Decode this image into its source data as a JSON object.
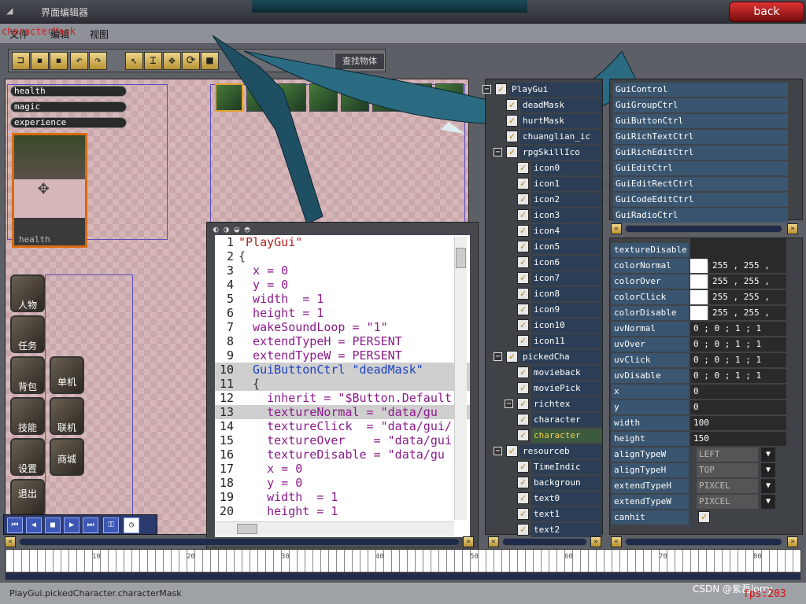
{
  "window": {
    "title": "界面编辑器",
    "back_label": "back"
  },
  "menu": {
    "items": [
      "文件",
      "编辑",
      "视图"
    ],
    "overlay_text": "characterMask"
  },
  "toolbar": {
    "search_label": "查找物体"
  },
  "canvas": {
    "bars": [
      {
        "label": "health"
      },
      {
        "label": "magic"
      },
      {
        "label": "experience"
      }
    ],
    "portrait_label": "health",
    "side_buttons": [
      "人物",
      "任务",
      "背包",
      "技能",
      "设置",
      "退出"
    ],
    "side_buttons2": [
      "单机",
      "联机",
      "商城"
    ]
  },
  "code": {
    "lines": [
      {
        "n": "1",
        "t": "\"PlayGui\""
      },
      {
        "n": "2",
        "t": "{"
      },
      {
        "n": "3",
        "t": "  x = 0"
      },
      {
        "n": "4",
        "t": "  y = 0"
      },
      {
        "n": "5",
        "t": "  width  = 1"
      },
      {
        "n": "6",
        "t": "  height = 1"
      },
      {
        "n": "7",
        "t": "  wakeSoundLoop = \"1\""
      },
      {
        "n": "8",
        "t": "  extendTypeH = PERSENT"
      },
      {
        "n": "9",
        "t": "  extendTypeW = PERSENT"
      },
      {
        "n": "10",
        "t": "  GuiButtonCtrl \"deadMask\""
      },
      {
        "n": "11",
        "t": "  {"
      },
      {
        "n": "12",
        "t": "    inherit = \"$Button.Default"
      },
      {
        "n": "13",
        "t": "    textureNormal = \"data/gu"
      },
      {
        "n": "14",
        "t": "    textureClick  = \"data/gui/"
      },
      {
        "n": "15",
        "t": "    textureOver    = \"data/gui"
      },
      {
        "n": "16",
        "t": "    textureDisable = \"data/gu"
      },
      {
        "n": "17",
        "t": "    x = 0"
      },
      {
        "n": "18",
        "t": "    y = 0"
      },
      {
        "n": "19",
        "t": "    width  = 1"
      },
      {
        "n": "20",
        "t": "    height = 1"
      }
    ]
  },
  "tree": {
    "items": [
      {
        "label": "PlayGui",
        "depth": 0,
        "expand": true
      },
      {
        "label": "deadMask",
        "depth": 1
      },
      {
        "label": "hurtMask",
        "depth": 1
      },
      {
        "label": "chuanglian_ic",
        "depth": 1
      },
      {
        "label": "rpgSkillIco",
        "depth": 1,
        "expand": true
      },
      {
        "label": "icon0",
        "depth": 2
      },
      {
        "label": "icon1",
        "depth": 2
      },
      {
        "label": "icon2",
        "depth": 2
      },
      {
        "label": "icon3",
        "depth": 2
      },
      {
        "label": "icon4",
        "depth": 2
      },
      {
        "label": "icon5",
        "depth": 2
      },
      {
        "label": "icon6",
        "depth": 2
      },
      {
        "label": "icon7",
        "depth": 2
      },
      {
        "label": "icon8",
        "depth": 2
      },
      {
        "label": "icon9",
        "depth": 2
      },
      {
        "label": "icon10",
        "depth": 2
      },
      {
        "label": "icon11",
        "depth": 2
      },
      {
        "label": "pickedCha",
        "depth": 1,
        "expand": true
      },
      {
        "label": "movieback",
        "depth": 2
      },
      {
        "label": "moviePick",
        "depth": 2
      },
      {
        "label": "richtex",
        "depth": 2,
        "expand": true
      },
      {
        "label": "character",
        "depth": 2
      },
      {
        "label": "character",
        "depth": 2,
        "selected": true
      },
      {
        "label": "resourceb",
        "depth": 1,
        "expand": true
      },
      {
        "label": "TimeIndic",
        "depth": 2
      },
      {
        "label": "backgroun",
        "depth": 2
      },
      {
        "label": "text0",
        "depth": 2
      },
      {
        "label": "text1",
        "depth": 2
      },
      {
        "label": "text2",
        "depth": 2
      }
    ]
  },
  "controls": {
    "items": [
      "GuiControl",
      "GuiGroupCtrl",
      "GuiButtonCtrl",
      "GuiRichTextCtrl",
      "GuiRichEditCtrl",
      "GuiEditCtrl",
      "GuiEditRectCtrl",
      "GuiCodeEditCtrl",
      "GuiRadioCtrl"
    ]
  },
  "properties": {
    "rows": [
      {
        "name": "textureDisable",
        "value": "",
        "type": "blank"
      },
      {
        "name": "colorNormal",
        "value": "255 , 255 ,",
        "type": "color"
      },
      {
        "name": "colorOver",
        "value": "255 , 255 ,",
        "type": "color"
      },
      {
        "name": "colorClick",
        "value": "255 , 255 ,",
        "type": "color"
      },
      {
        "name": "colorDisable",
        "value": "255 , 255 ,",
        "type": "color"
      },
      {
        "name": "uvNormal",
        "value": "0 ; 0 ; 1 ; 1",
        "type": "text"
      },
      {
        "name": "uvOver",
        "value": "0 ; 0 ; 1 ; 1",
        "type": "text"
      },
      {
        "name": "uvClick",
        "value": "0 ; 0 ; 1 ; 1",
        "type": "text"
      },
      {
        "name": "uvDisable",
        "value": "0 ; 0 ; 1 ; 1",
        "type": "text"
      },
      {
        "name": "x",
        "value": "0",
        "type": "text"
      },
      {
        "name": "y",
        "value": "0",
        "type": "text"
      },
      {
        "name": "width",
        "value": "100",
        "type": "text"
      },
      {
        "name": "height",
        "value": "150",
        "type": "text"
      },
      {
        "name": "alignTypeW",
        "value": "LEFT",
        "type": "select"
      },
      {
        "name": "alignTypeH",
        "value": "TOP",
        "type": "select"
      },
      {
        "name": "extendTypeH",
        "value": "PIXCEL",
        "type": "select"
      },
      {
        "name": "extendTypeW",
        "value": "PIXCEL",
        "type": "select"
      },
      {
        "name": "canhit",
        "value": "",
        "type": "check"
      }
    ]
  },
  "timeline": {
    "ticks": [
      "10",
      "20",
      "30",
      "40",
      "50",
      "60",
      "70",
      "80"
    ]
  },
  "status": {
    "text": "PlayGui.pickedCharacter.characterMask",
    "fps": "fps:203",
    "watermark": "CSDN @紫磊lorry"
  },
  "colors": {
    "accent": "#b89232",
    "panel": "#3a5570",
    "selected_text": "#f2d04a"
  }
}
